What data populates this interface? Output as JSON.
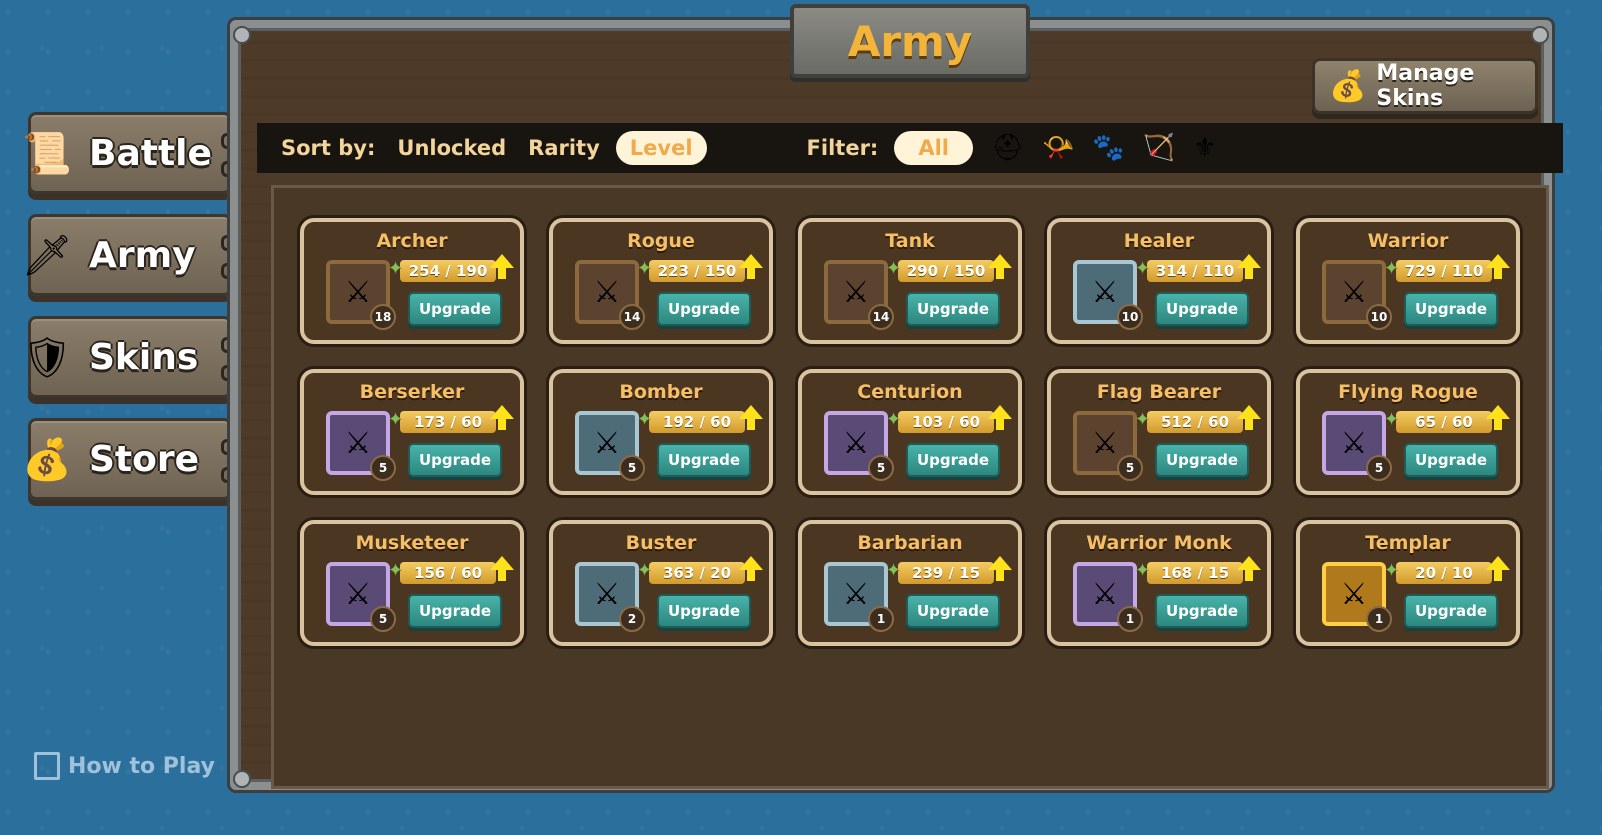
{
  "nav": {
    "battle": {
      "label": "Battle",
      "icon": "scroll-map-icon"
    },
    "army": {
      "label": "Army",
      "icon": "hero-icon"
    },
    "skins": {
      "label": "Skins",
      "icon": "armor-icon"
    },
    "store": {
      "label": "Store",
      "icon": "coin-bag-icon"
    }
  },
  "how_to_play": "How to Play",
  "title": "Army",
  "manage_skins": "Manage Skins",
  "sort": {
    "label": "Sort by:",
    "options": [
      "Unlocked",
      "Rarity",
      "Level"
    ],
    "selected": "Level"
  },
  "filter": {
    "label": "Filter:",
    "all": "All",
    "icons": [
      "helmet-icon",
      "horn-icon",
      "paw-icon",
      "bow-icon",
      "wing-icon"
    ]
  },
  "upgrade_label": "Upgrade",
  "units": [
    {
      "name": "Archer",
      "shards": "254 / 190",
      "level": "18",
      "rarity": "common"
    },
    {
      "name": "Rogue",
      "shards": "223 / 150",
      "level": "14",
      "rarity": "common"
    },
    {
      "name": "Tank",
      "shards": "290 / 150",
      "level": "14",
      "rarity": "common"
    },
    {
      "name": "Healer",
      "shards": "314 / 110",
      "level": "10",
      "rarity": "rare"
    },
    {
      "name": "Warrior",
      "shards": "729 / 110",
      "level": "10",
      "rarity": "common"
    },
    {
      "name": "Berserker",
      "shards": "173 / 60",
      "level": "5",
      "rarity": "epic"
    },
    {
      "name": "Bomber",
      "shards": "192 / 60",
      "level": "5",
      "rarity": "rare"
    },
    {
      "name": "Centurion",
      "shards": "103 / 60",
      "level": "5",
      "rarity": "epic"
    },
    {
      "name": "Flag Bearer",
      "shards": "512 / 60",
      "level": "5",
      "rarity": "common"
    },
    {
      "name": "Flying Rogue",
      "shards": "65 / 60",
      "level": "5",
      "rarity": "epic"
    },
    {
      "name": "Musketeer",
      "shards": "156 / 60",
      "level": "5",
      "rarity": "epic"
    },
    {
      "name": "Buster",
      "shards": "363 / 20",
      "level": "2",
      "rarity": "rare"
    },
    {
      "name": "Barbarian",
      "shards": "239 / 15",
      "level": "1",
      "rarity": "rare"
    },
    {
      "name": "Warrior Monk",
      "shards": "168 / 15",
      "level": "1",
      "rarity": "epic"
    },
    {
      "name": "Templar",
      "shards": "20 / 10",
      "level": "1",
      "rarity": "legendary"
    }
  ]
}
